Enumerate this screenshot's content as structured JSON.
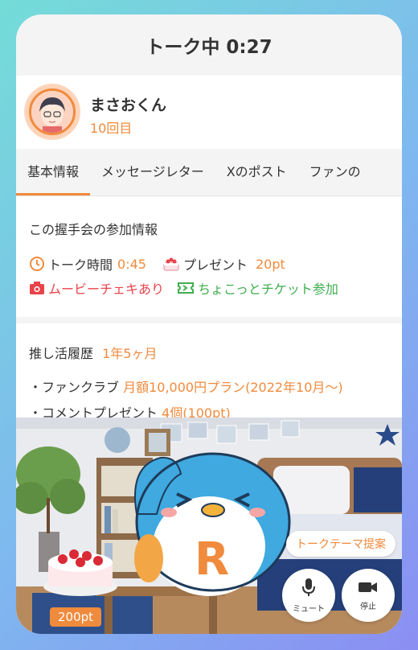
{
  "header": {
    "title": "トーク中 0:27"
  },
  "profile": {
    "name": "まさおくん",
    "count": "10回目"
  },
  "tabs": [
    {
      "label": "基本情報",
      "active": true
    },
    {
      "label": "メッセージレター"
    },
    {
      "label": "Xのポスト"
    },
    {
      "label": "ファンの"
    }
  ],
  "info": {
    "title": "この握手会の参加情報",
    "talk_time_label": "トーク時間",
    "talk_time_value": "0:45",
    "present_label": "プレゼント",
    "present_value": "20pt",
    "movie_cheki": "ムービーチェキあり",
    "ticket": "ちょこっとチケット参加"
  },
  "history": {
    "title": "推し活履歴",
    "duration": "1年5ヶ月",
    "fanclub_label": "・ファンクラブ",
    "fanclub_value": "月額10,000円プラン(2022年10月〜)",
    "comment_label": "・コメントプレゼント",
    "comment_value": "4個(100pt)"
  },
  "scene": {
    "theme_button": "トークテーマ提案",
    "mute_label": "ミュート",
    "stop_label": "停止",
    "cake_price": "200pt",
    "mascot_letter": "R"
  },
  "colors": {
    "accent": "#f08a3c",
    "red": "#e8434a",
    "green": "#3fae4e"
  },
  "icons": [
    "clock-icon",
    "cake-icon",
    "camera-icon",
    "ticket-icon",
    "mic-icon",
    "video-camera-icon",
    "star-icon"
  ]
}
